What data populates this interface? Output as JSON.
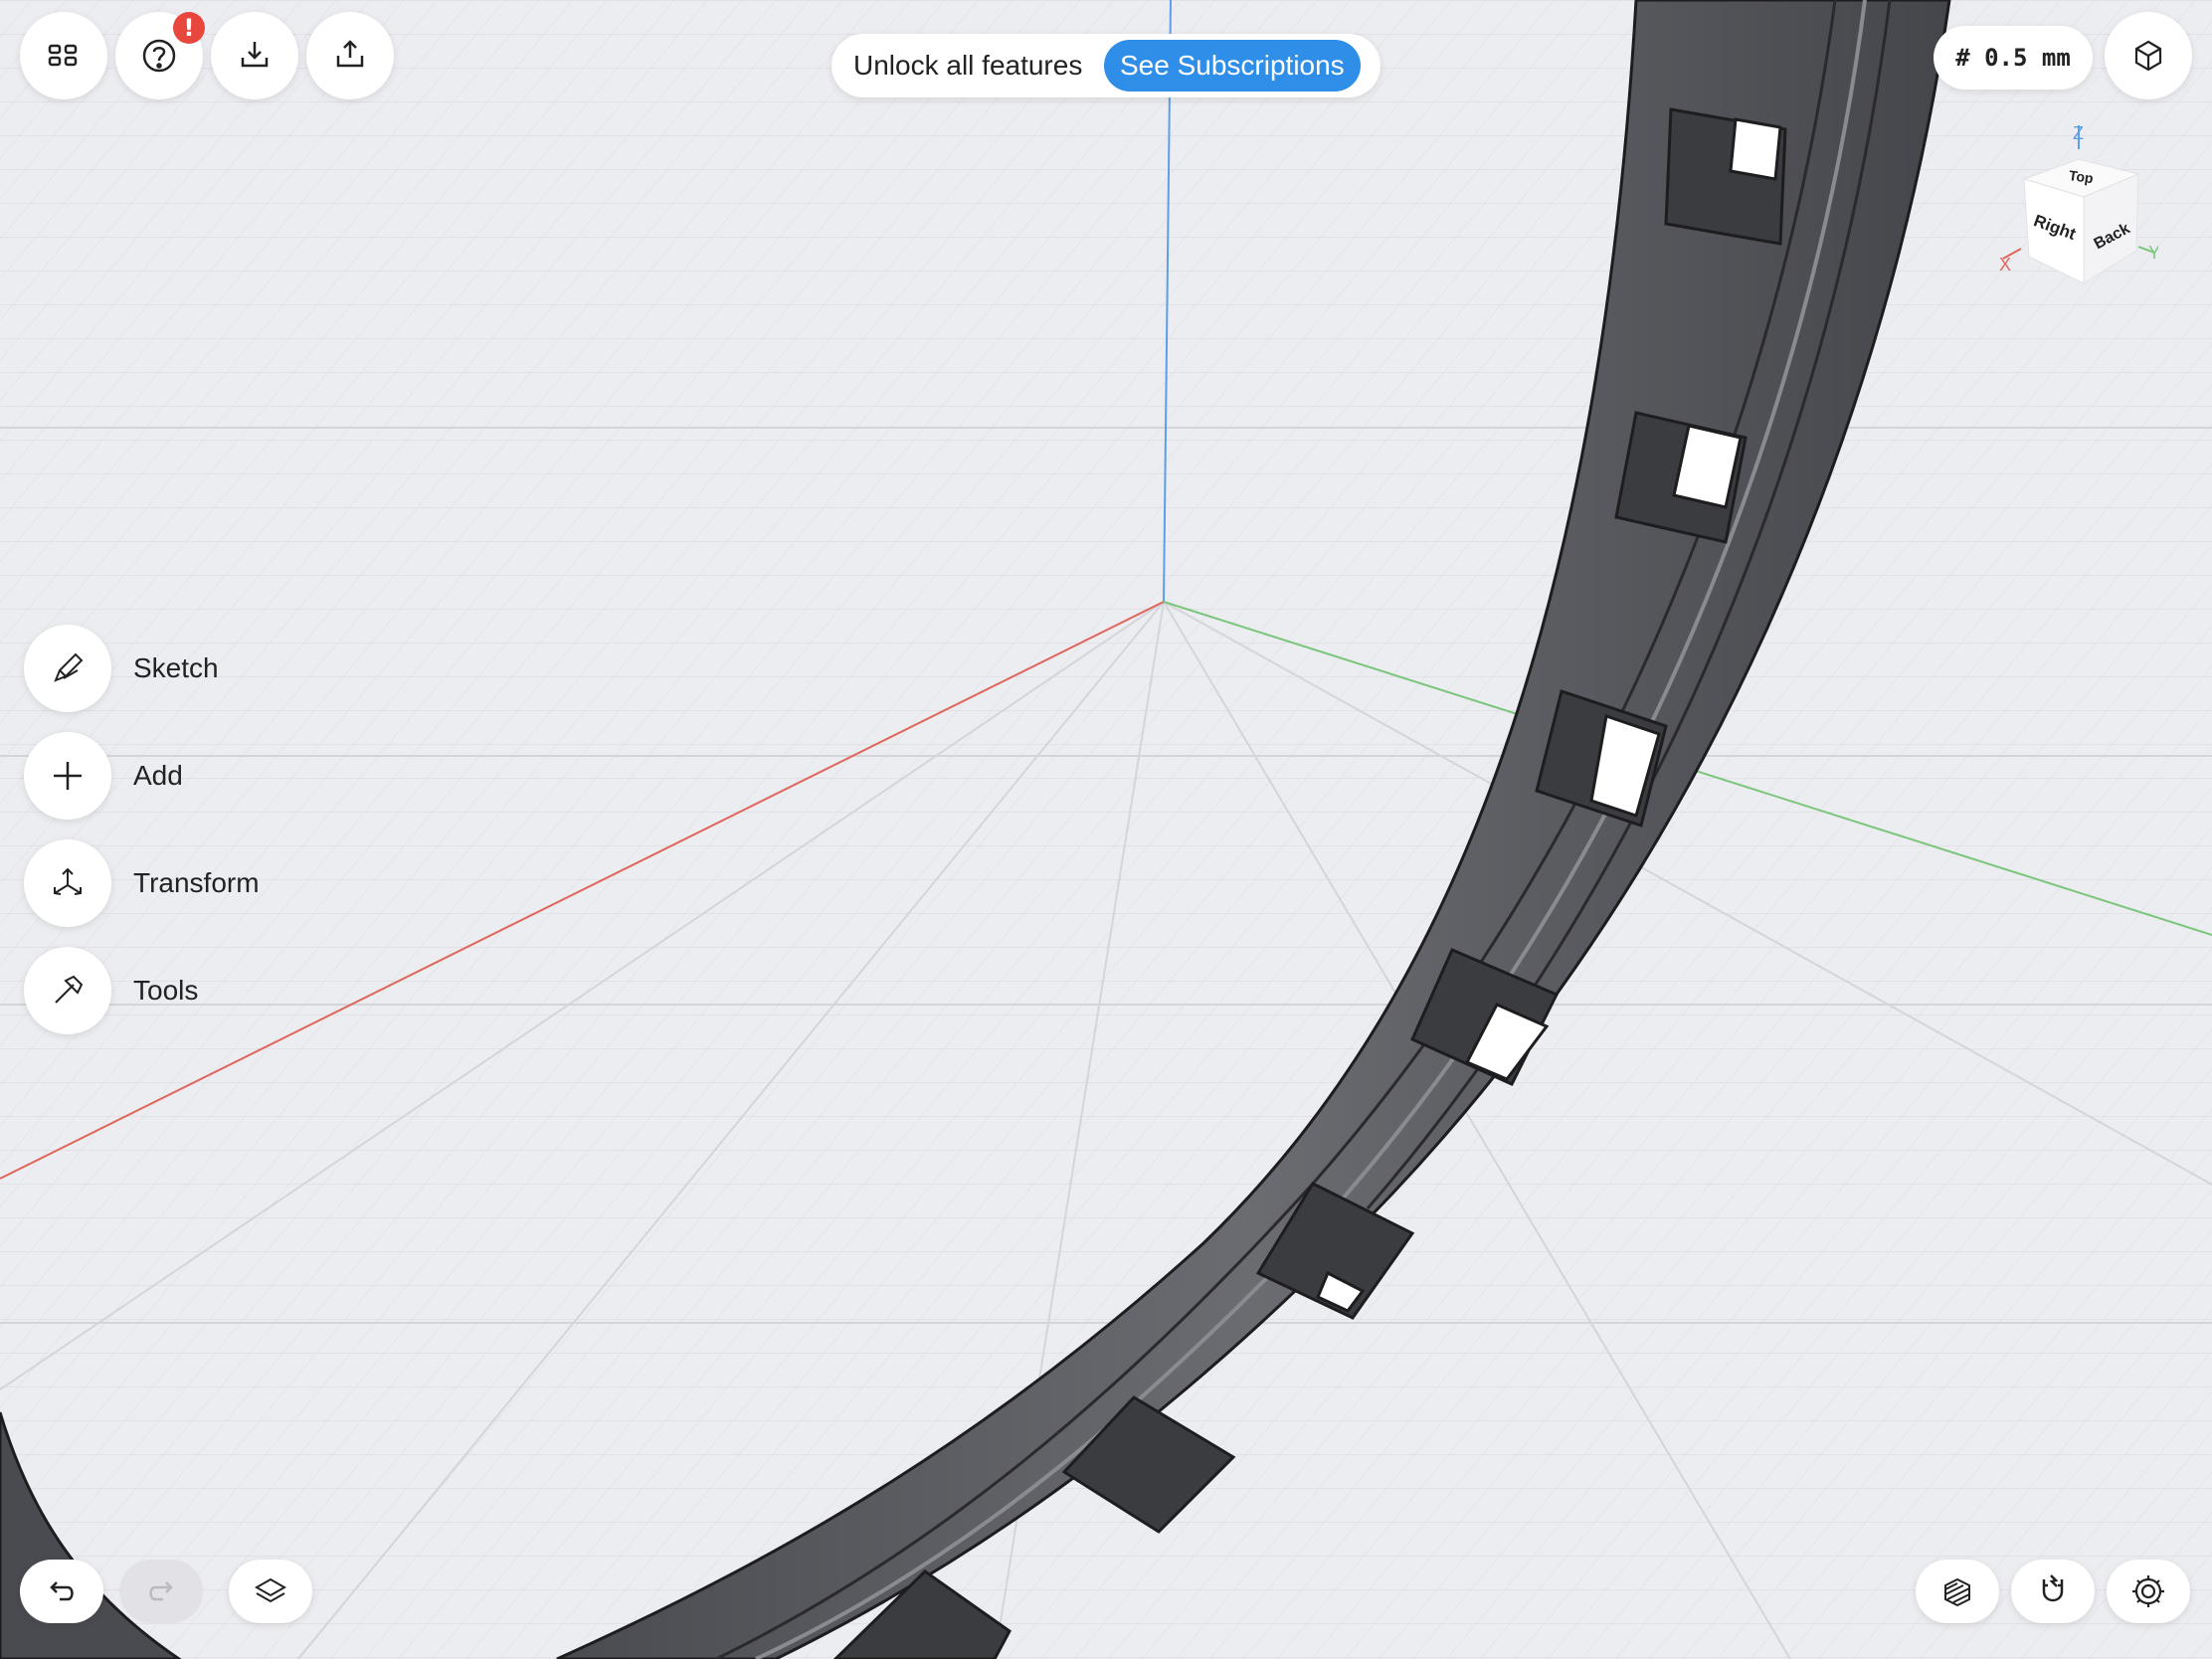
{
  "toolbar": {
    "left_icons": [
      "grid-icon",
      "help-icon",
      "import-icon",
      "export-icon"
    ],
    "help_badge": "!"
  },
  "promo": {
    "text": "Unlock all features",
    "button": "See Subscriptions",
    "accent": "#2f8ee8"
  },
  "grid_size": "# 0.5 mm",
  "view_cube": {
    "faces": {
      "top": "Top",
      "right": "Right",
      "back": "Back"
    },
    "axes": {
      "x": "X",
      "y": "Y",
      "z": "Z"
    },
    "axis_colors": {
      "x": "#e0665c",
      "y": "#6cbf6c",
      "z": "#5b9fe8"
    }
  },
  "side_menu": [
    {
      "label": "Sketch",
      "icon": "pencil-icon"
    },
    {
      "label": "Add",
      "icon": "plus-icon"
    },
    {
      "label": "Transform",
      "icon": "move-arrows-icon"
    },
    {
      "label": "Tools",
      "icon": "hammer-icon"
    }
  ],
  "bottom_left_icons": [
    "undo-icon",
    "redo-icon",
    "layers-icon"
  ],
  "bottom_right_icons": [
    "section-view-icon",
    "snap-magnet-icon",
    "settings-gear-icon"
  ],
  "colors": {
    "background": "#ecedf0",
    "model": "#5a5b60",
    "danger": "#e8473e"
  }
}
